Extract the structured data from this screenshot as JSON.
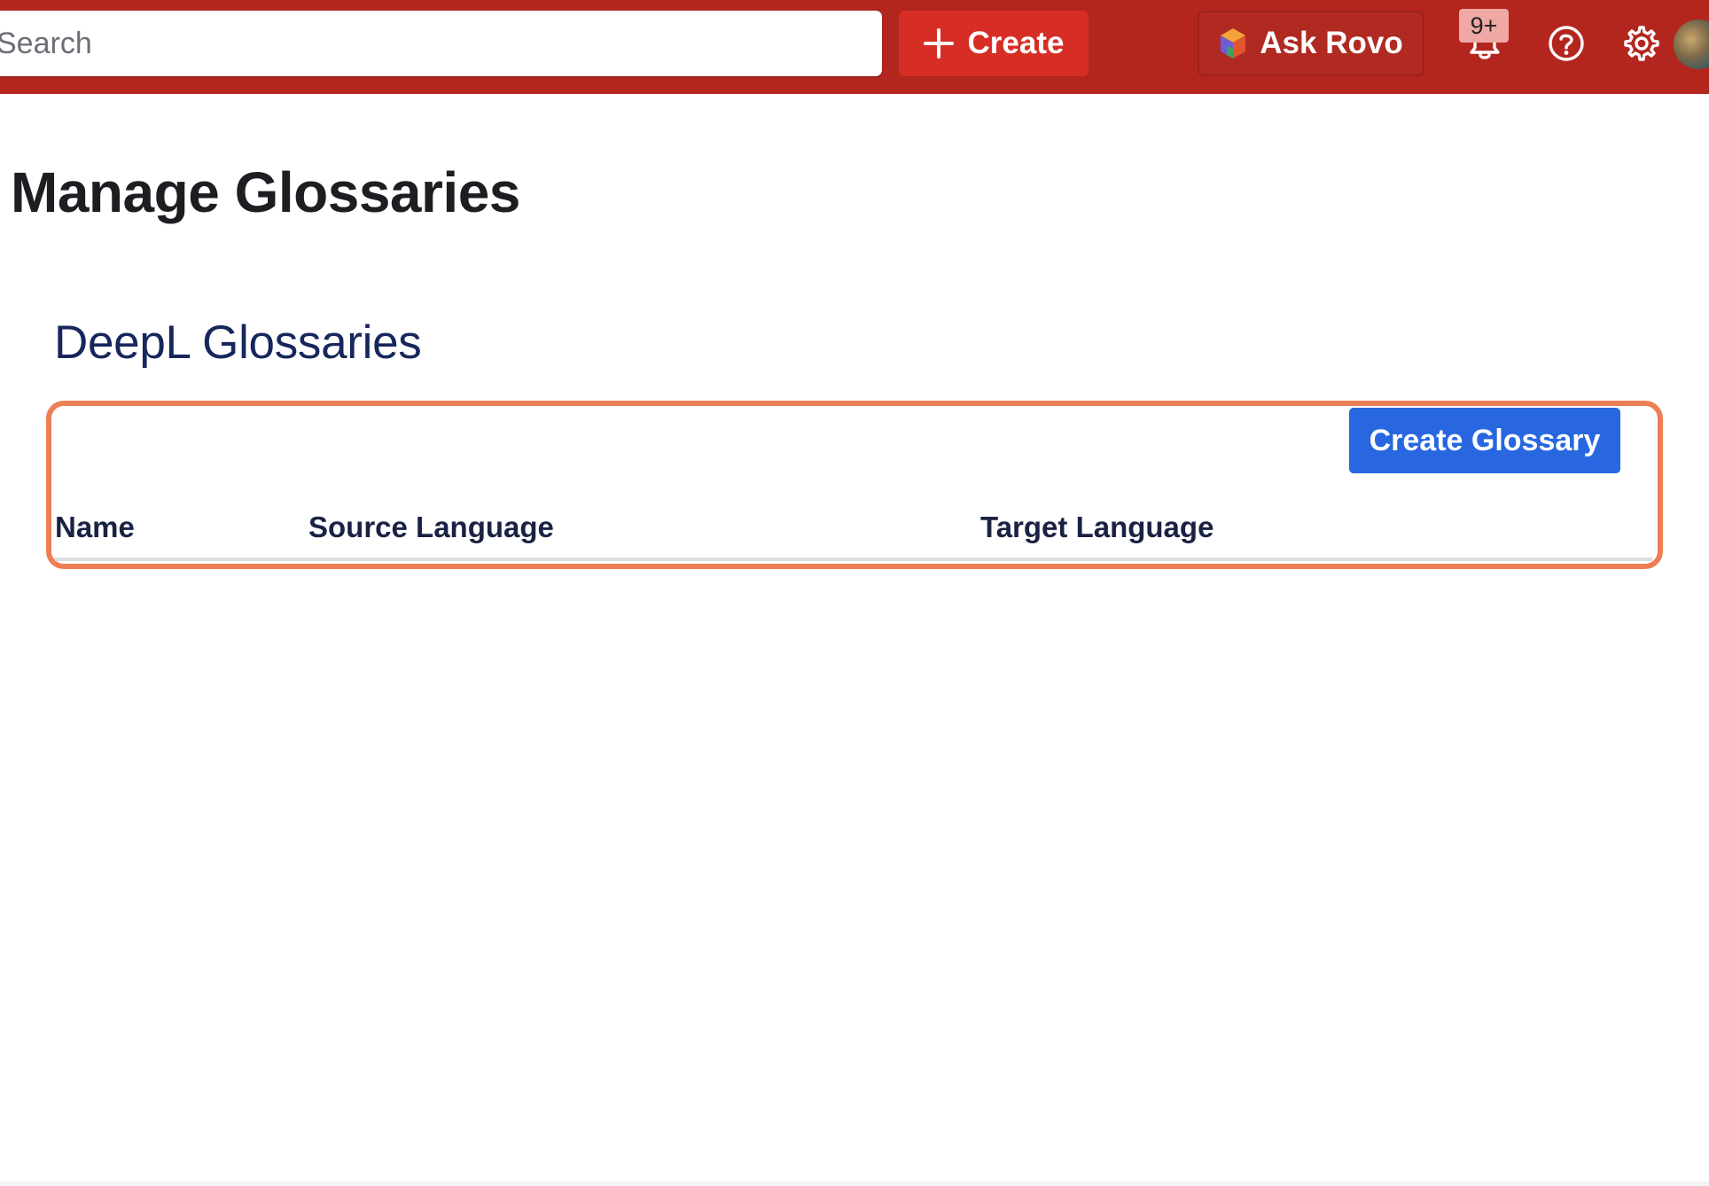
{
  "topbar": {
    "background_color": "#b3261e",
    "search": {
      "placeholder": "Search"
    },
    "create_label": "Create",
    "ask_rovo_label": "Ask Rovo",
    "notifications_badge": "9+",
    "icons": [
      "plus-icon",
      "rovo-logo-icon",
      "bell-icon",
      "help-icon",
      "gear-icon",
      "avatar"
    ]
  },
  "main": {
    "page_title": "Manage Glossaries",
    "section_title": "DeepL Glossaries",
    "create_glossary_label": "Create Glossary",
    "table": {
      "columns": [
        "Name",
        "Source Language",
        "Target Language"
      ],
      "rows": []
    }
  },
  "colors": {
    "primary_button": "#2867e0",
    "create_button": "#d62e25",
    "highlight_outline": "#ec7f55"
  }
}
